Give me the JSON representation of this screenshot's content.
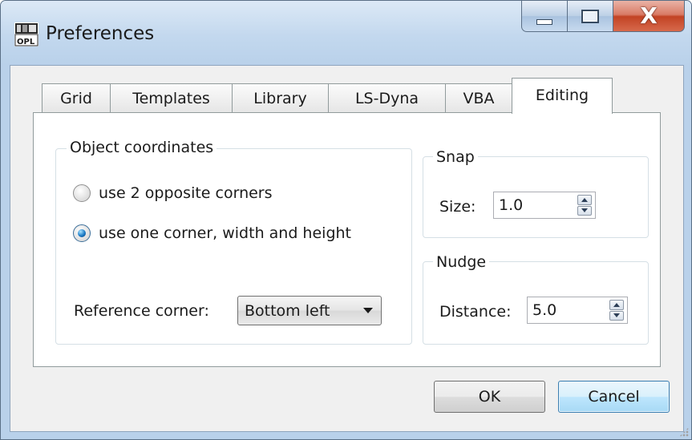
{
  "window": {
    "title": "Preferences",
    "icon": "opl-app-icon"
  },
  "caption_buttons": {
    "minimize_icon": "minimize-icon",
    "maximize_icon": "maximize-icon",
    "close_icon": "close-icon",
    "close_glyph": "X"
  },
  "tabs": [
    {
      "label": "Grid",
      "active": false
    },
    {
      "label": "Templates",
      "active": false
    },
    {
      "label": "Library",
      "active": false
    },
    {
      "label": "LS-Dyna",
      "active": false
    },
    {
      "label": "VBA",
      "active": false
    },
    {
      "label": "Editing",
      "active": true
    }
  ],
  "object_coordinates": {
    "title": "Object coordinates",
    "options": [
      {
        "label": "use 2 opposite corners",
        "checked": false
      },
      {
        "label": "use one corner, width and height",
        "checked": true
      }
    ],
    "reference_corner_label": "Reference corner:",
    "reference_corner_value": "Bottom left"
  },
  "snap": {
    "title": "Snap",
    "size_label": "Size:",
    "size_value": "1.0"
  },
  "nudge": {
    "title": "Nudge",
    "distance_label": "Distance:",
    "distance_value": "5.0"
  },
  "buttons": {
    "ok": "OK",
    "cancel": "Cancel"
  },
  "colors": {
    "frame": "#b9d1ea",
    "close_button": "#c24324",
    "default_button": "#bee6fd"
  }
}
